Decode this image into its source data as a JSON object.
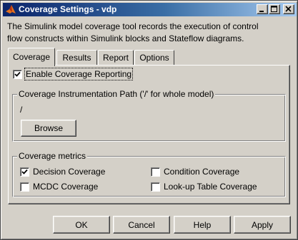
{
  "window": {
    "title": "Coverage Settings - vdp",
    "app_icon": "matlab-logo-icon",
    "controls": {
      "minimize": "minimize-icon",
      "maximize": "maximize-icon",
      "close": "close-icon"
    }
  },
  "description": {
    "line1": "The Simulink model coverage tool records the execution of control",
    "line2": "flow constructs within Simulink blocks and Stateflow diagrams."
  },
  "tabs": [
    {
      "label": "Coverage",
      "active": true
    },
    {
      "label": "Results",
      "active": false
    },
    {
      "label": "Report",
      "active": false
    },
    {
      "label": "Options",
      "active": false
    }
  ],
  "coverage_tab": {
    "enable": {
      "label": "Enable Coverage Reporting",
      "checked": true
    },
    "instrumentation": {
      "legend": "Coverage Instrumentation Path ('/' for whole model)",
      "path_value": "/",
      "browse_label": "Browse"
    },
    "metrics": {
      "legend": "Coverage metrics",
      "items": [
        {
          "label": "Decision Coverage",
          "checked": true
        },
        {
          "label": "Condition Coverage",
          "checked": false
        },
        {
          "label": "MCDC Coverage",
          "checked": false
        },
        {
          "label": "Look-up Table Coverage",
          "checked": false
        }
      ]
    }
  },
  "buttons": {
    "ok": "OK",
    "cancel": "Cancel",
    "help": "Help",
    "apply": "Apply"
  }
}
